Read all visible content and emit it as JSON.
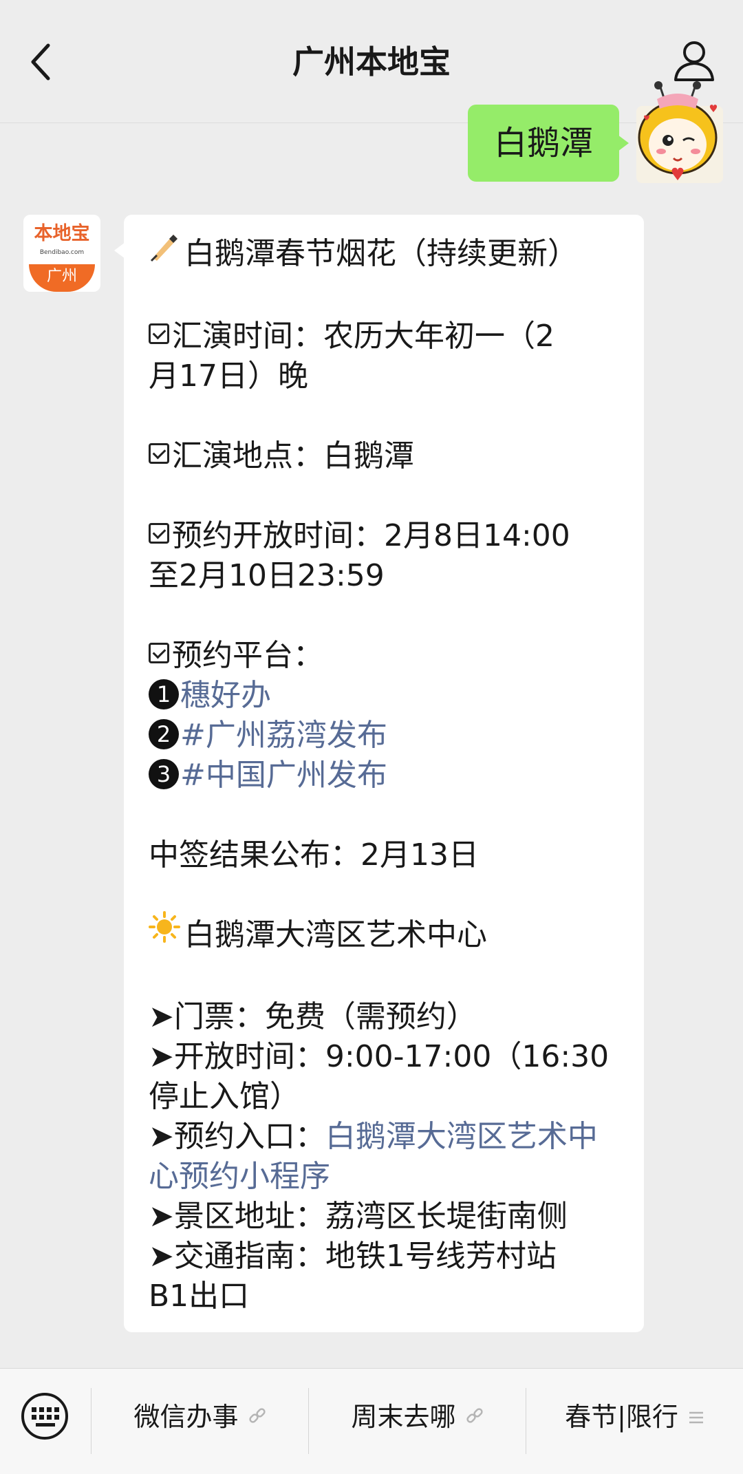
{
  "header": {
    "title": "广州本地宝"
  },
  "user_message": {
    "text": "白鹅潭"
  },
  "bot_avatar": {
    "logo_text": "本地宝",
    "logo_domain": "Bendibao.com",
    "logo_city": "广州"
  },
  "bot_message": {
    "heading": "白鹅潭春节烟花（持续更新）",
    "time_line_1": "汇演时间：农历大年初一（2",
    "time_line_2": "月17日）晚",
    "place": "汇演地点：白鹅潭",
    "open_line_1": "预约开放时间：2月8日14:00",
    "open_line_2": "至2月10日23:59",
    "platform_label": "预约平台：",
    "platforms": [
      {
        "num": "1",
        "text": "穗好办"
      },
      {
        "num": "2",
        "text": "#广州荔湾发布"
      },
      {
        "num": "3",
        "text": "#中国广州发布"
      }
    ],
    "result": "中签结果公布：2月13日",
    "center_heading": "白鹅潭大湾区艺术中心",
    "ticket": "➤门票：免费（需预约）",
    "hours_line_1": "➤开放时间：9:00-17:00（16:30",
    "hours_line_2": "停止入馆）",
    "entry_label": "➤预约入口：",
    "entry_link_1": "白鹅潭大湾区艺术中",
    "entry_link_2": "心预约小程序",
    "address": "➤景区地址：荔湾区长堤街南侧",
    "transit_line_1": "➤交通指南：地铁1号线芳村站",
    "transit_line_2": "B1出口"
  },
  "bottom_menu": {
    "items": [
      {
        "label": "微信办事"
      },
      {
        "label": "周末去哪"
      },
      {
        "label": "春节|限行"
      }
    ]
  },
  "icons": {
    "back": "chevron-left-icon",
    "profile": "person-icon",
    "keyboard": "keyboard-icon",
    "writing": "writing-hand-icon",
    "checkbox": "check-box-icon",
    "sun": "sun-icon",
    "link": "link-icon",
    "menu": "menu-lines-icon"
  },
  "colors": {
    "background": "#ededed",
    "user_bubble": "#95ec69",
    "link": "#576b95",
    "brand_orange": "#f06b25"
  }
}
